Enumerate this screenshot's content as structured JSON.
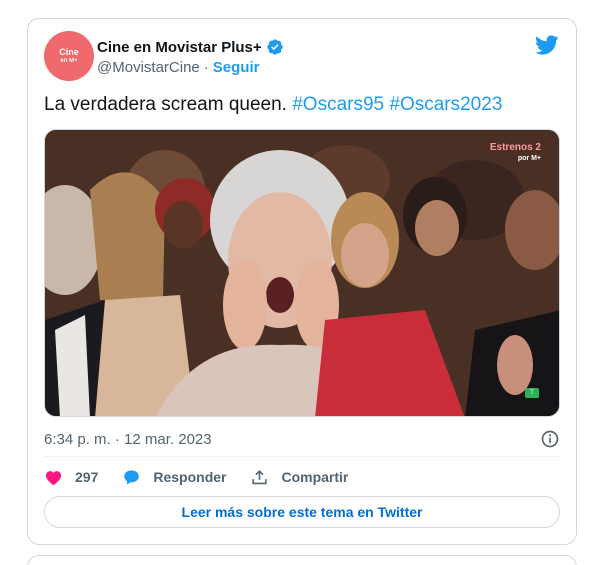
{
  "author": {
    "display_name": "Cine en Movistar Plus+",
    "handle": "@MovistarCine",
    "separator": "·",
    "follow_label": "Seguir",
    "avatar_line1": "Cine",
    "avatar_line2": "en M+",
    "avatar_color": "#f0696d"
  },
  "tweet": {
    "text": "La verdadera scream queen.",
    "hashtags": [
      "#Oscars95",
      "#Oscars2023"
    ]
  },
  "media": {
    "watermark_line1": "Estrenos 2",
    "watermark_line2": "por M+",
    "badge": "T"
  },
  "meta": {
    "time": "6:34 p. m.",
    "separator": "·",
    "date": "12 mar. 2023",
    "info_icon": "info-circle-icon"
  },
  "actions": {
    "likes": "297",
    "reply_label": "Responder",
    "share_label": "Compartir"
  },
  "read_more_label": "Leer más sobre este tema en Twitter",
  "colors": {
    "accent": "#1d9bf0",
    "like": "#f91880",
    "link_button": "#006fd6",
    "muted": "#536471"
  }
}
